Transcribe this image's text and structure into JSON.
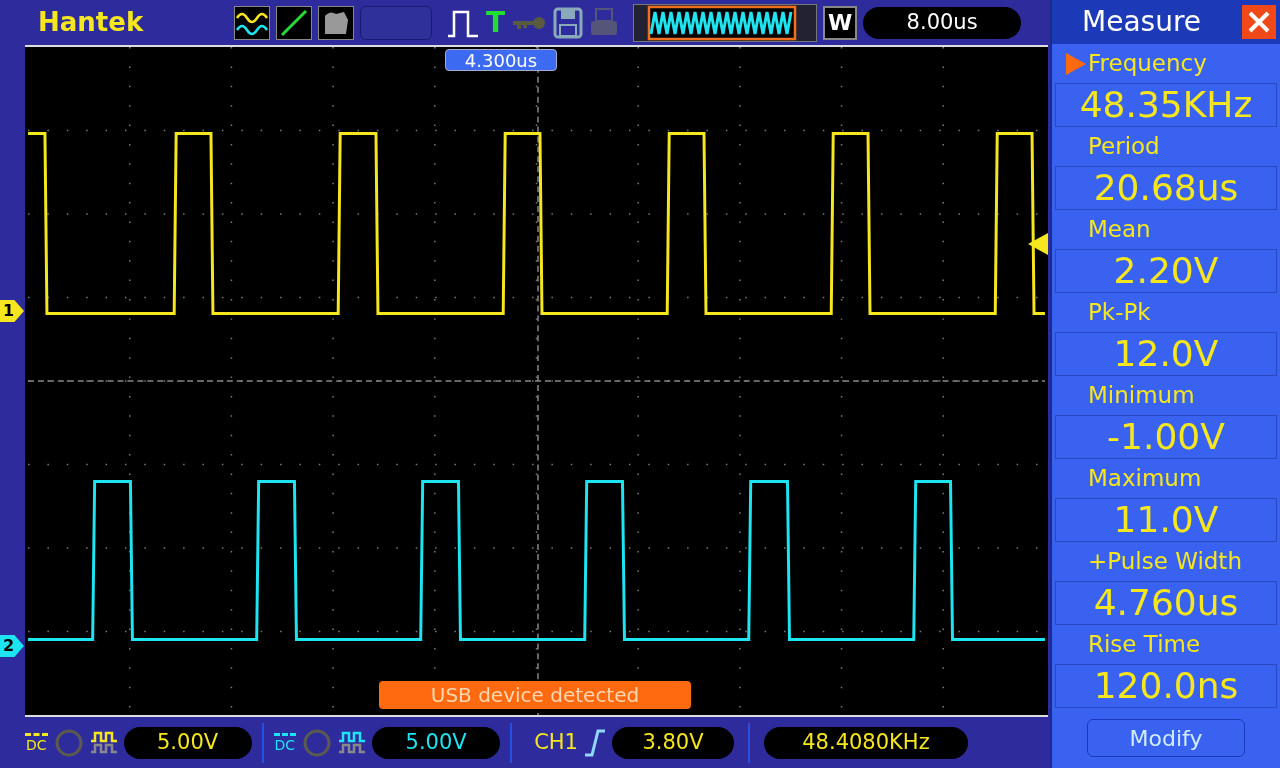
{
  "brand": "Hantek",
  "toolbar": {
    "trigger_letter": "T",
    "window_mode": "W",
    "timebase": "8.00us"
  },
  "trigger_position": "4.300us",
  "channels": [
    {
      "marker": "1",
      "color": "#f5e61e",
      "coupling": "DC",
      "volts_div": "5.00V"
    },
    {
      "marker": "2",
      "color": "#1ee3f0",
      "coupling": "DC",
      "volts_div": "5.00V"
    }
  ],
  "trigger": {
    "source": "CH1",
    "level": "3.80V"
  },
  "frequency_counter": "48.4080KHz",
  "notification": "USB device detected",
  "measure_panel": {
    "title": "Measure",
    "modify_button": "Modify",
    "items": [
      {
        "label": "Frequency",
        "value": "48.35KHz",
        "selected": true
      },
      {
        "label": "Period",
        "value": "20.68us",
        "selected": false
      },
      {
        "label": "Mean",
        "value": "2.20V",
        "selected": false
      },
      {
        "label": "Pk-Pk",
        "value": "12.0V",
        "selected": false
      },
      {
        "label": "Minimum",
        "value": "-1.00V",
        "selected": false
      },
      {
        "label": "Maximum",
        "value": "11.0V",
        "selected": false
      },
      {
        "label": "+Pulse Width",
        "value": "4.760us",
        "selected": false
      },
      {
        "label": "Rise Time",
        "value": "120.0ns",
        "selected": false
      }
    ]
  }
}
